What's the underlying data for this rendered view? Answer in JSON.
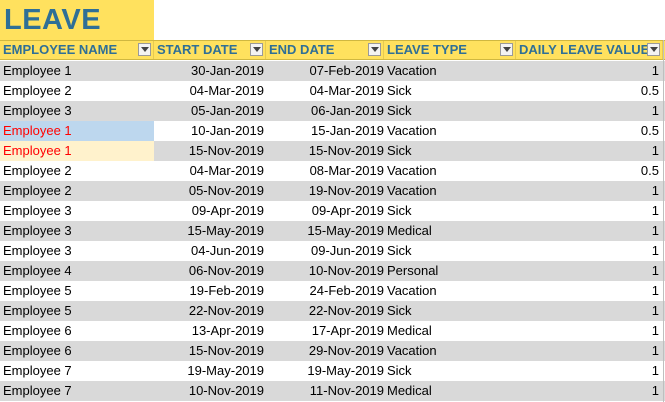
{
  "sheet": {
    "title": "LEAVE",
    "columns": [
      {
        "key": "employee",
        "label": "EMPLOYEE NAME"
      },
      {
        "key": "start",
        "label": "START DATE"
      },
      {
        "key": "end",
        "label": "END DATE"
      },
      {
        "key": "type",
        "label": "LEAVE TYPE"
      },
      {
        "key": "value",
        "label": "DAILY LEAVE VALUE"
      }
    ],
    "rows": [
      {
        "employee": "Employee 1",
        "start": "30-Jan-2019",
        "end": "07-Feb-2019",
        "type": "Vacation",
        "value": "1"
      },
      {
        "employee": "Employee 2",
        "start": "04-Mar-2019",
        "end": "04-Mar-2019",
        "type": "Sick",
        "value": "0.5"
      },
      {
        "employee": "Employee 3",
        "start": "05-Jan-2019",
        "end": "06-Jan-2019",
        "type": "Sick",
        "value": "1"
      },
      {
        "employee": "Employee 1",
        "start": "10-Jan-2019",
        "end": "15-Jan-2019",
        "type": "Vacation",
        "value": "0.5"
      },
      {
        "employee": "Employee 1",
        "start": "15-Nov-2019",
        "end": "15-Nov-2019",
        "type": "Sick",
        "value": "1"
      },
      {
        "employee": "Employee 2",
        "start": "04-Mar-2019",
        "end": "08-Mar-2019",
        "type": "Vacation",
        "value": "0.5"
      },
      {
        "employee": "Employee 2",
        "start": "05-Nov-2019",
        "end": "19-Nov-2019",
        "type": "Vacation",
        "value": "1"
      },
      {
        "employee": "Employee 3",
        "start": "09-Apr-2019",
        "end": "09-Apr-2019",
        "type": "Sick",
        "value": "1"
      },
      {
        "employee": "Employee 3",
        "start": "15-May-2019",
        "end": "15-May-2019",
        "type": "Medical",
        "value": "1"
      },
      {
        "employee": "Employee 3",
        "start": "04-Jun-2019",
        "end": "09-Jun-2019",
        "type": "Sick",
        "value": "1"
      },
      {
        "employee": "Employee 4",
        "start": "06-Nov-2019",
        "end": "10-Nov-2019",
        "type": "Personal",
        "value": "1"
      },
      {
        "employee": "Employee 5",
        "start": "19-Feb-2019",
        "end": "24-Feb-2019",
        "type": "Vacation",
        "value": "1"
      },
      {
        "employee": "Employee 5",
        "start": "22-Nov-2019",
        "end": "22-Nov-2019",
        "type": "Sick",
        "value": "1"
      },
      {
        "employee": "Employee 6",
        "start": "13-Apr-2019",
        "end": "17-Apr-2019",
        "type": "Medical",
        "value": "1"
      },
      {
        "employee": "Employee 6",
        "start": "15-Nov-2019",
        "end": "29-Nov-2019",
        "type": "Vacation",
        "value": "1"
      },
      {
        "employee": "Employee 7",
        "start": "19-May-2019",
        "end": "19-May-2019",
        "type": "Sick",
        "value": "1"
      },
      {
        "employee": "Employee 7",
        "start": "10-Nov-2019",
        "end": "11-Nov-2019",
        "type": "Medical",
        "value": "1"
      }
    ]
  },
  "colors": {
    "header_fill": "#ffe15e",
    "header_text": "#2f6f96",
    "band_shaded": "#d9d9d9",
    "highlight_blue": "#bdd7ee",
    "highlight_cream": "#fff2cc",
    "warning_text": "#ff0000"
  },
  "icons": {
    "filter": "chevron-down-icon"
  }
}
